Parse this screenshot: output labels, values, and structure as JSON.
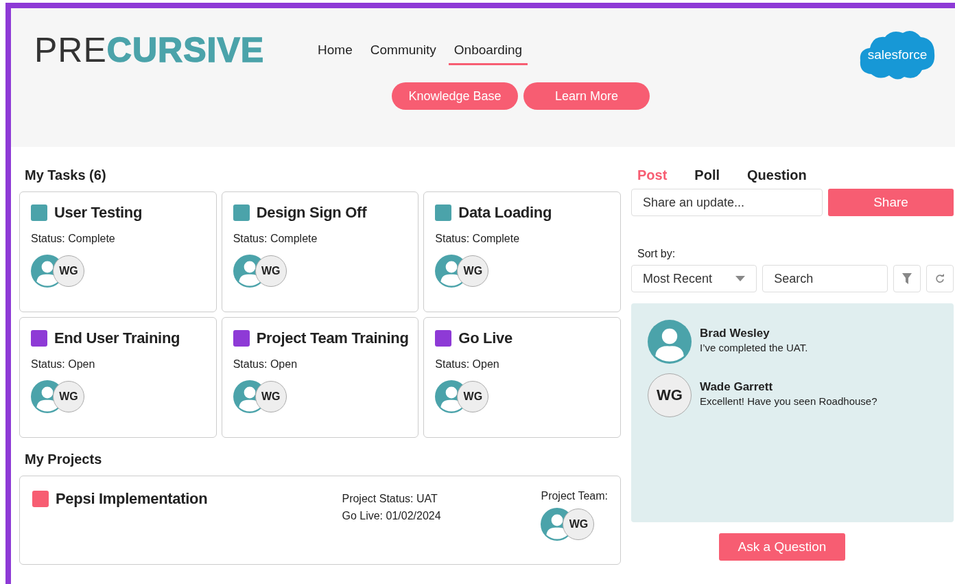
{
  "header": {
    "logo": {
      "light": "PRE",
      "bold": "CURSIVE"
    },
    "nav": [
      {
        "label": "Home",
        "selected": false
      },
      {
        "label": "Community",
        "selected": false
      },
      {
        "label": "Onboarding",
        "selected": true
      }
    ],
    "buttons": [
      "Knowledge Base",
      "Learn More"
    ],
    "partner_logo": "salesforce"
  },
  "tasks": {
    "title": "My Tasks (6)",
    "items": [
      {
        "title": "User Testing",
        "status": "Status: Complete",
        "color": "#4ba3aa",
        "avatars": [
          "WG"
        ]
      },
      {
        "title": "Design Sign Off",
        "status": "Status: Complete",
        "color": "#4ba3aa",
        "avatars": [
          "WG"
        ]
      },
      {
        "title": "Data Loading",
        "status": "Status: Complete",
        "color": "#4ba3aa",
        "avatars": [
          "WG"
        ]
      },
      {
        "title": "End User Training",
        "status": "Status: Open",
        "color": "#8e3ad6",
        "avatars": [
          "WG"
        ]
      },
      {
        "title": "Project Team Training",
        "status": "Status: Open",
        "color": "#8e3ad6",
        "avatars": [
          "WG"
        ]
      },
      {
        "title": "Go Live",
        "status": "Status: Open",
        "color": "#8e3ad6",
        "avatars": [
          "WG"
        ]
      }
    ]
  },
  "projects": {
    "title": "My Projects",
    "items": [
      {
        "title": "Pepsi Implementation",
        "color": "#f75d72",
        "status": "Project Status: UAT",
        "go_live": "Go Live: 01/02/2024",
        "team_label": "Project Team:",
        "avatars": [
          "WG"
        ]
      }
    ]
  },
  "feed": {
    "tabs": [
      {
        "label": "Post",
        "selected": true
      },
      {
        "label": "Poll",
        "selected": false
      },
      {
        "label": "Question",
        "selected": false
      }
    ],
    "share_placeholder": "Share an update...",
    "share_button": "Share",
    "sort_label": "Sort by:",
    "sort_value": "Most Recent",
    "search_placeholder": "Search",
    "posts": [
      {
        "author": "Brad Wesley",
        "text": "I’ve completed the UAT.",
        "avatar": {
          "kind": "silhouette"
        }
      },
      {
        "author": "Wade Garrett",
        "text": "Excellent! Have you seen Roadhouse?",
        "avatar": {
          "kind": "initials",
          "initials": "WG"
        }
      }
    ],
    "ask_button": "Ask a Question"
  }
}
